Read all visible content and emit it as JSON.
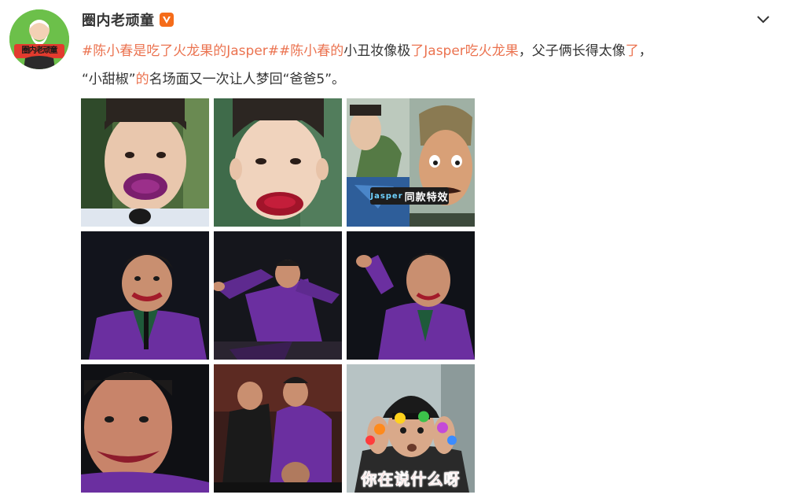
{
  "user": {
    "name": "圈内老顽童",
    "avatar_text": "圈内老顽童",
    "verified_badge_icon": "verified-v-icon"
  },
  "post": {
    "line1": [
      {
        "text": "#陈小春是吃了火龙果的Jasper#",
        "link": true
      },
      {
        "text": "#陈小春的",
        "link": true
      },
      {
        "text": "小丑妆像极",
        "link": false
      },
      {
        "text": "了Jasper吃火龙果",
        "link": true
      },
      {
        "text": "，父子俩长得太像",
        "link": false
      },
      {
        "text": "了",
        "link": true
      },
      {
        "text": "，",
        "link": false
      }
    ],
    "line2": [
      {
        "text": "“小甜椒”",
        "link": false
      },
      {
        "text": "的",
        "link": true
      },
      {
        "text": "名场面又一次让人梦回“爸爸5”。",
        "link": false
      }
    ]
  },
  "images": [
    {
      "name": "photo-boy-purple-mouth",
      "overlay": ""
    },
    {
      "name": "photo-boy-red-mouth",
      "overlay": ""
    },
    {
      "name": "photo-boy-and-puppet",
      "overlay_a": "Jasper",
      "overlay_b": "同款特效"
    },
    {
      "name": "photo-clown-purple-suit-1",
      "overlay": ""
    },
    {
      "name": "photo-clown-dance",
      "overlay": ""
    },
    {
      "name": "photo-clown-pointing",
      "overlay": ""
    },
    {
      "name": "photo-clown-closeup",
      "overlay": ""
    },
    {
      "name": "photo-clown-duo",
      "overlay": ""
    },
    {
      "name": "photo-man-cap-confused",
      "caption": "你在说什么呀"
    }
  ],
  "colors": {
    "link": "#eb7350",
    "text": "#333333",
    "verified": "#f56c1a",
    "avatar_bg": "#6cc04a"
  }
}
